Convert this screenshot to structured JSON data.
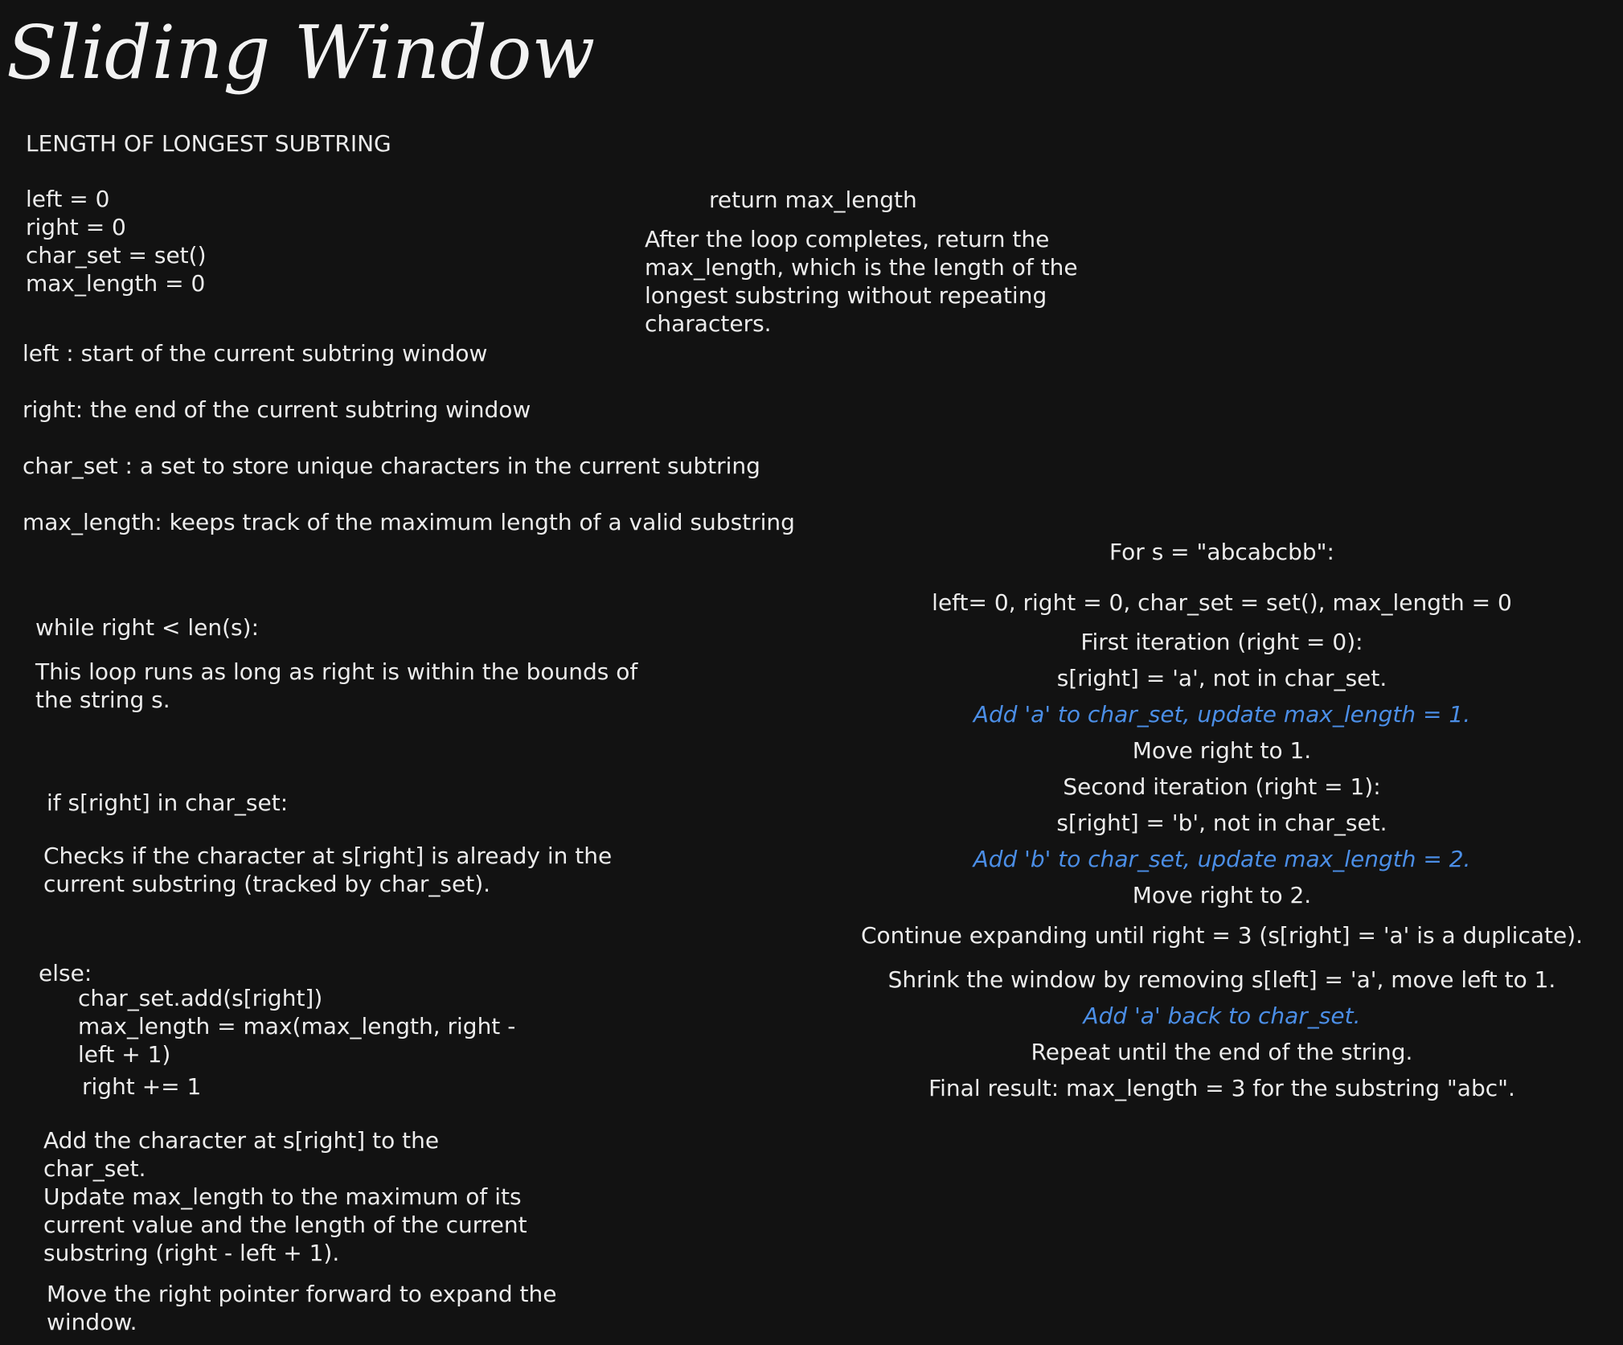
{
  "title": "Sliding Window",
  "heading": "LENGTH OF LONGEST SUBTRING",
  "init_code": [
    "left = 0",
    "right = 0",
    "char_set = set()",
    "max_length = 0"
  ],
  "definitions": {
    "left": "left : start of the current subtring window",
    "right": "right: the end of the current subtring window",
    "char_set": "char_set : a set to store unique characters in the current subtring",
    "max_length": "max_length: keeps track of the maximum length of a valid substring"
  },
  "while_block": {
    "code": "while right < len(s):",
    "desc": [
      "This loop runs as long as right is within the bounds of",
      "the string s."
    ]
  },
  "if_block": {
    "code": "if s[right] in char_set:",
    "desc": [
      "Checks if the character at s[right] is already in the",
      "current substring (tracked by char_set)."
    ]
  },
  "else_block": {
    "code": [
      "else:",
      "char_set.add(s[right])",
      "max_length = max(max_length, right -",
      "left + 1)",
      "right += 1"
    ],
    "desc": [
      "Add the character at s[right] to the",
      "char_set.",
      "Update max_length to the maximum of its",
      "current value and the length of the current",
      "substring (right - left + 1)."
    ],
    "desc2": [
      "Move the right pointer forward to expand the",
      "window."
    ]
  },
  "return_block": {
    "code": "return max_length",
    "desc": [
      "After the loop completes, return the",
      "max_length, which is the length of the",
      "longest substring without repeating",
      "characters."
    ]
  },
  "example": {
    "header": "For s = \"abcabcbb\":",
    "lines": [
      {
        "text": "left= 0, right = 0, char_set = set(), max_length = 0",
        "highlight": false
      },
      {
        "text": "First iteration (right = 0):",
        "highlight": false
      },
      {
        "text": "s[right] = 'a', not in char_set.",
        "highlight": false
      },
      {
        "text": "Add 'a' to char_set, update max_length = 1.",
        "highlight": true
      },
      {
        "text": "Move right to 1.",
        "highlight": false
      },
      {
        "text": "Second iteration (right = 1):",
        "highlight": false
      },
      {
        "text": "s[right] = 'b', not in char_set.",
        "highlight": false
      },
      {
        "text": "Add 'b' to char_set, update max_length = 2.",
        "highlight": true
      },
      {
        "text": "Move right to 2.",
        "highlight": false
      },
      {
        "text": "Continue expanding until right = 3 (s[right] = 'a' is a duplicate).",
        "highlight": false
      },
      {
        "text": "Shrink the window by removing s[left] = 'a', move left to 1.",
        "highlight": false
      },
      {
        "text": "Add 'a' back to char_set.",
        "highlight": true
      },
      {
        "text": "Repeat until the end of the string.",
        "highlight": false
      },
      {
        "text": "Final result: max_length = 3 for the substring \"abc\".",
        "highlight": false
      }
    ]
  },
  "colors": {
    "background": "#121212",
    "text": "#ececec",
    "highlight": "#4b8ee6"
  }
}
